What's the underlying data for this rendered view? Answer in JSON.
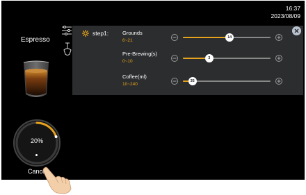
{
  "clock": {
    "time": "16:37",
    "date": "2023/08/09"
  },
  "drink": {
    "name": "Espresso",
    "cup_icon": "espresso-glass"
  },
  "side_icons": [
    "sliders-icon",
    "grinder-icon"
  ],
  "dial": {
    "percent_label": "20%",
    "progress": 0.2
  },
  "cancel_label": "Cancel",
  "panel": {
    "step_icon": "gear-icon",
    "step_label": "step1:",
    "rows": [
      {
        "name": "Grounds",
        "range": "6~21",
        "min": 6,
        "max": 21,
        "value": 14,
        "value_label": "14"
      },
      {
        "name": "Pre-Brewing(s)",
        "range": "0~10",
        "min": 0,
        "max": 10,
        "value": 3,
        "value_label": "3"
      },
      {
        "name": "Coffee(ml)",
        "range": "10~240",
        "min": 10,
        "max": 240,
        "value": 35,
        "value_label": "35"
      }
    ]
  },
  "colors": {
    "accent": "#e6a11d",
    "panel": "#2b2d2e",
    "background": "#000000"
  }
}
